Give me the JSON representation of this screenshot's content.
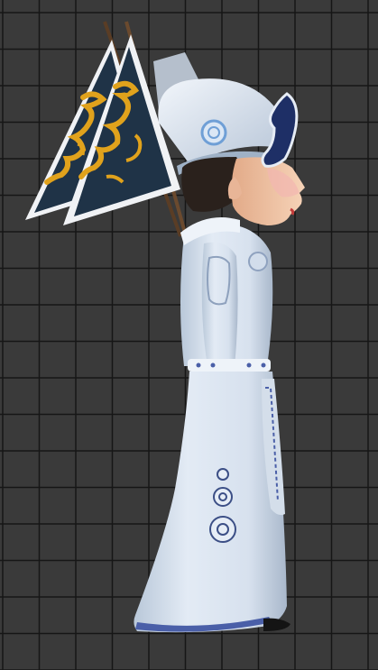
{
  "viewport": {
    "background_color": "#3a3a3a",
    "grid_line_color": "#161616"
  },
  "model": {
    "robe_color": "#dfe8f3",
    "robe_shadow_color": "#aebccd",
    "trim_color": "#4a5fa8",
    "banner_field_color": "#1f3347",
    "banner_dragon_color": "#e0a21c",
    "banner_edge_color": "#eef1f4",
    "pole_color": "#6b4a2e",
    "skin_color": "#f1c6a6",
    "hair_color": "#2a211c",
    "mask_color": "#1e2f66",
    "shoe_color": "#141414"
  }
}
